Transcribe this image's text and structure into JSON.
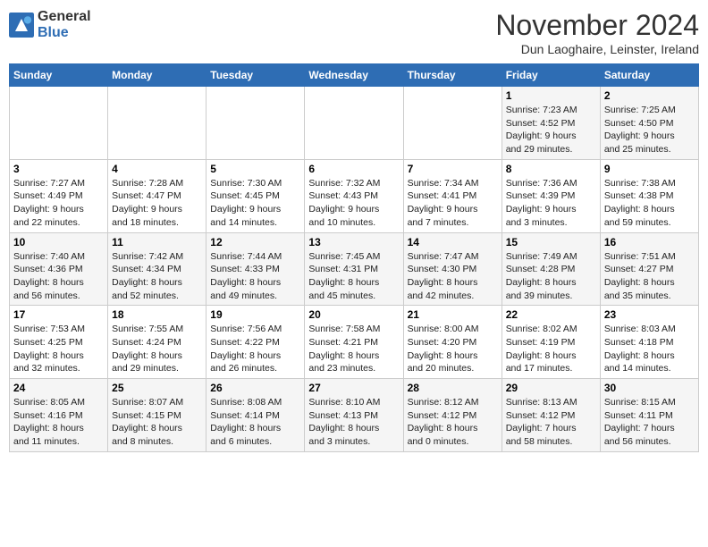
{
  "header": {
    "logo_general": "General",
    "logo_blue": "Blue",
    "month_year": "November 2024",
    "location": "Dun Laoghaire, Leinster, Ireland"
  },
  "weekdays": [
    "Sunday",
    "Monday",
    "Tuesday",
    "Wednesday",
    "Thursday",
    "Friday",
    "Saturday"
  ],
  "weeks": [
    {
      "days": [
        {
          "num": "",
          "info": ""
        },
        {
          "num": "",
          "info": ""
        },
        {
          "num": "",
          "info": ""
        },
        {
          "num": "",
          "info": ""
        },
        {
          "num": "",
          "info": ""
        },
        {
          "num": "1",
          "info": "Sunrise: 7:23 AM\nSunset: 4:52 PM\nDaylight: 9 hours\nand 29 minutes."
        },
        {
          "num": "2",
          "info": "Sunrise: 7:25 AM\nSunset: 4:50 PM\nDaylight: 9 hours\nand 25 minutes."
        }
      ]
    },
    {
      "days": [
        {
          "num": "3",
          "info": "Sunrise: 7:27 AM\nSunset: 4:49 PM\nDaylight: 9 hours\nand 22 minutes."
        },
        {
          "num": "4",
          "info": "Sunrise: 7:28 AM\nSunset: 4:47 PM\nDaylight: 9 hours\nand 18 minutes."
        },
        {
          "num": "5",
          "info": "Sunrise: 7:30 AM\nSunset: 4:45 PM\nDaylight: 9 hours\nand 14 minutes."
        },
        {
          "num": "6",
          "info": "Sunrise: 7:32 AM\nSunset: 4:43 PM\nDaylight: 9 hours\nand 10 minutes."
        },
        {
          "num": "7",
          "info": "Sunrise: 7:34 AM\nSunset: 4:41 PM\nDaylight: 9 hours\nand 7 minutes."
        },
        {
          "num": "8",
          "info": "Sunrise: 7:36 AM\nSunset: 4:39 PM\nDaylight: 9 hours\nand 3 minutes."
        },
        {
          "num": "9",
          "info": "Sunrise: 7:38 AM\nSunset: 4:38 PM\nDaylight: 8 hours\nand 59 minutes."
        }
      ]
    },
    {
      "days": [
        {
          "num": "10",
          "info": "Sunrise: 7:40 AM\nSunset: 4:36 PM\nDaylight: 8 hours\nand 56 minutes."
        },
        {
          "num": "11",
          "info": "Sunrise: 7:42 AM\nSunset: 4:34 PM\nDaylight: 8 hours\nand 52 minutes."
        },
        {
          "num": "12",
          "info": "Sunrise: 7:44 AM\nSunset: 4:33 PM\nDaylight: 8 hours\nand 49 minutes."
        },
        {
          "num": "13",
          "info": "Sunrise: 7:45 AM\nSunset: 4:31 PM\nDaylight: 8 hours\nand 45 minutes."
        },
        {
          "num": "14",
          "info": "Sunrise: 7:47 AM\nSunset: 4:30 PM\nDaylight: 8 hours\nand 42 minutes."
        },
        {
          "num": "15",
          "info": "Sunrise: 7:49 AM\nSunset: 4:28 PM\nDaylight: 8 hours\nand 39 minutes."
        },
        {
          "num": "16",
          "info": "Sunrise: 7:51 AM\nSunset: 4:27 PM\nDaylight: 8 hours\nand 35 minutes."
        }
      ]
    },
    {
      "days": [
        {
          "num": "17",
          "info": "Sunrise: 7:53 AM\nSunset: 4:25 PM\nDaylight: 8 hours\nand 32 minutes."
        },
        {
          "num": "18",
          "info": "Sunrise: 7:55 AM\nSunset: 4:24 PM\nDaylight: 8 hours\nand 29 minutes."
        },
        {
          "num": "19",
          "info": "Sunrise: 7:56 AM\nSunset: 4:22 PM\nDaylight: 8 hours\nand 26 minutes."
        },
        {
          "num": "20",
          "info": "Sunrise: 7:58 AM\nSunset: 4:21 PM\nDaylight: 8 hours\nand 23 minutes."
        },
        {
          "num": "21",
          "info": "Sunrise: 8:00 AM\nSunset: 4:20 PM\nDaylight: 8 hours\nand 20 minutes."
        },
        {
          "num": "22",
          "info": "Sunrise: 8:02 AM\nSunset: 4:19 PM\nDaylight: 8 hours\nand 17 minutes."
        },
        {
          "num": "23",
          "info": "Sunrise: 8:03 AM\nSunset: 4:18 PM\nDaylight: 8 hours\nand 14 minutes."
        }
      ]
    },
    {
      "days": [
        {
          "num": "24",
          "info": "Sunrise: 8:05 AM\nSunset: 4:16 PM\nDaylight: 8 hours\nand 11 minutes."
        },
        {
          "num": "25",
          "info": "Sunrise: 8:07 AM\nSunset: 4:15 PM\nDaylight: 8 hours\nand 8 minutes."
        },
        {
          "num": "26",
          "info": "Sunrise: 8:08 AM\nSunset: 4:14 PM\nDaylight: 8 hours\nand 6 minutes."
        },
        {
          "num": "27",
          "info": "Sunrise: 8:10 AM\nSunset: 4:13 PM\nDaylight: 8 hours\nand 3 minutes."
        },
        {
          "num": "28",
          "info": "Sunrise: 8:12 AM\nSunset: 4:12 PM\nDaylight: 8 hours\nand 0 minutes."
        },
        {
          "num": "29",
          "info": "Sunrise: 8:13 AM\nSunset: 4:12 PM\nDaylight: 7 hours\nand 58 minutes."
        },
        {
          "num": "30",
          "info": "Sunrise: 8:15 AM\nSunset: 4:11 PM\nDaylight: 7 hours\nand 56 minutes."
        }
      ]
    }
  ]
}
